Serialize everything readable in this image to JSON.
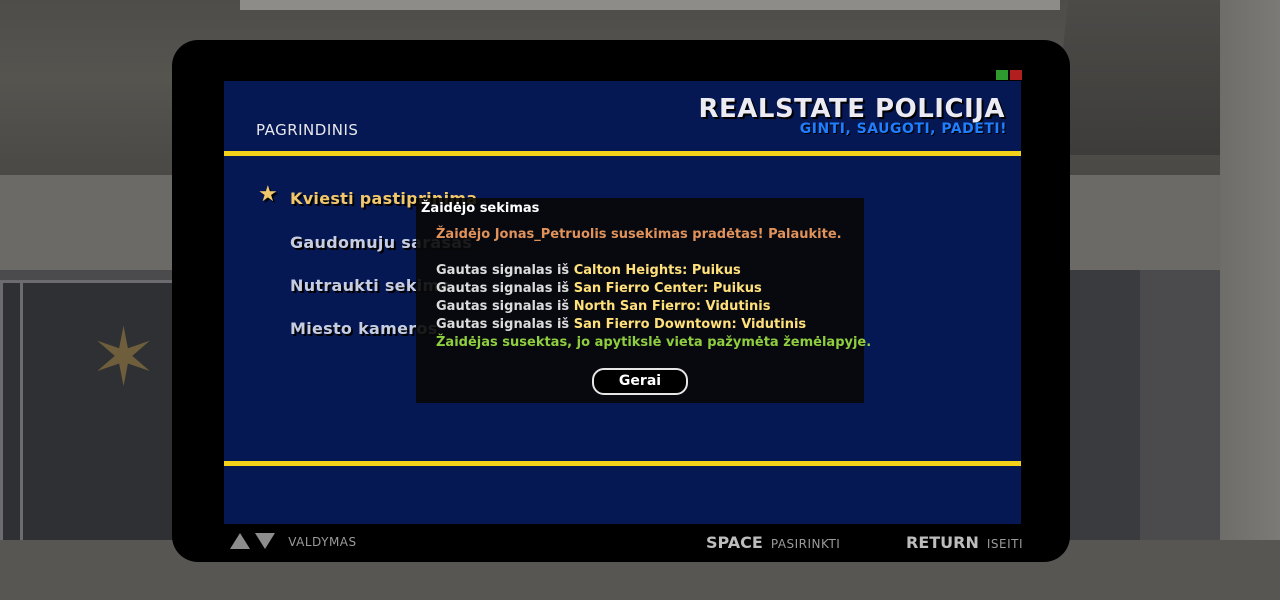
{
  "screen": {
    "section_title": "PAGRINDINIS",
    "brand_title": "REALSTATE POLICIJA",
    "brand_tagline": "GINTI, SAUGOTI, PADETI!",
    "status_lights": [
      "#2e9b2e",
      "#b21f1f"
    ]
  },
  "menu": {
    "items": [
      {
        "label": "Kviesti pastiprinima",
        "selected": true
      },
      {
        "label": "Gaudomuju sarasas",
        "selected": false
      },
      {
        "label": "Nutraukti sekima",
        "selected": false
      },
      {
        "label": "Miesto kameros",
        "selected": false
      }
    ]
  },
  "footer": {
    "nav_label": "VALDYMAS",
    "select_key": "SPACE",
    "select_label": "PASIRINKTI",
    "exit_key": "RETURN",
    "exit_label": "ISEITI"
  },
  "dialog": {
    "title": "Žaidėjo sekimas",
    "intro": "Žaidėjo Jonas_Petruolis susekimas pradėtas! Palaukite.",
    "signal_prefix": "Gautas signalas iš",
    "signals": [
      {
        "location": "Calton Heights",
        "quality": "Puikus"
      },
      {
        "location": "San Fierro Center",
        "quality": "Puikus"
      },
      {
        "location": "North San Fierro",
        "quality": "Vidutinis"
      },
      {
        "location": "San Fierro Downtown",
        "quality": "Vidutinis"
      }
    ],
    "result": "Žaidėjas susektas, jo apytikslė vieta pažymėta žemėlapyje.",
    "ok_label": "Gerai"
  },
  "colors": {
    "screen_bg": "#061853",
    "accent_rule": "#f4d21a",
    "brand_blue": "#1f7fff",
    "menu_selected": "#f1c76c",
    "dialog_orange": "#e0925a",
    "dialog_yellow": "#ffe07a",
    "dialog_green": "#8fce3e"
  }
}
